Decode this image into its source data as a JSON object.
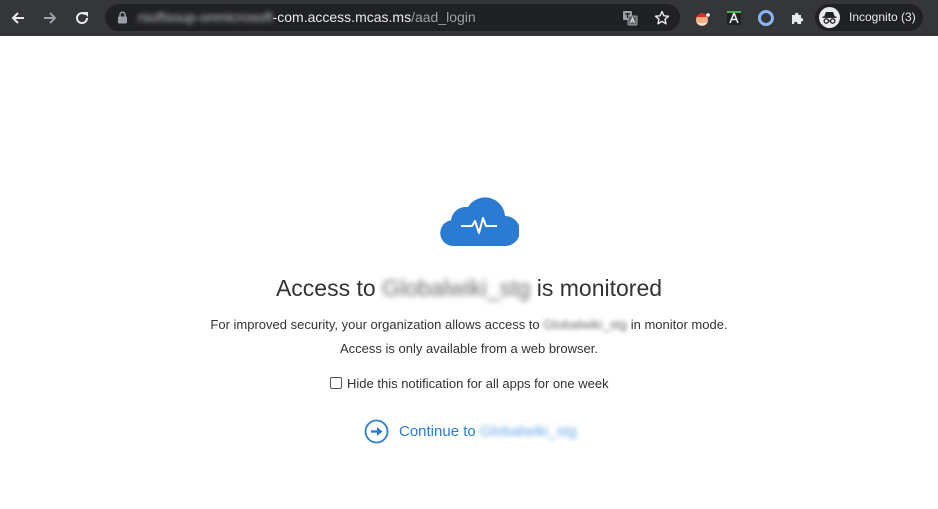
{
  "browser": {
    "url_host_hidden": "rsoftsoup-onmicrosoft",
    "url_host": "-com.access.mcas.ms",
    "url_path": "/aad_login",
    "profile_label": "Incognito (3)"
  },
  "page": {
    "title_prefix": "Access to",
    "app_name": "Globalwiki_stg",
    "title_suffix": "is monitored",
    "desc_line1_prefix": "For improved security, your organization allows access to",
    "desc_line1_suffix": "in monitor mode.",
    "desc_line2": "Access is only available from a web browser.",
    "hide_notification_label": "Hide this notification for all apps for one week",
    "hide_notification_checked": false,
    "continue_prefix": "Continue to"
  },
  "colors": {
    "toolbar_bg": "#35363a",
    "omnibox_bg": "#202124",
    "accent": "#2b7cd3",
    "cloud": "#2c7bd2"
  },
  "icons": [
    "back-arrow-icon",
    "forward-arrow-icon",
    "reload-icon",
    "lock-icon",
    "translate-icon",
    "star-icon",
    "extension-santa-icon",
    "extension-font-icon",
    "extension-ring-icon",
    "puzzle-icon",
    "incognito-icon",
    "cloud-monitor-icon",
    "continue-arrow-icon"
  ]
}
